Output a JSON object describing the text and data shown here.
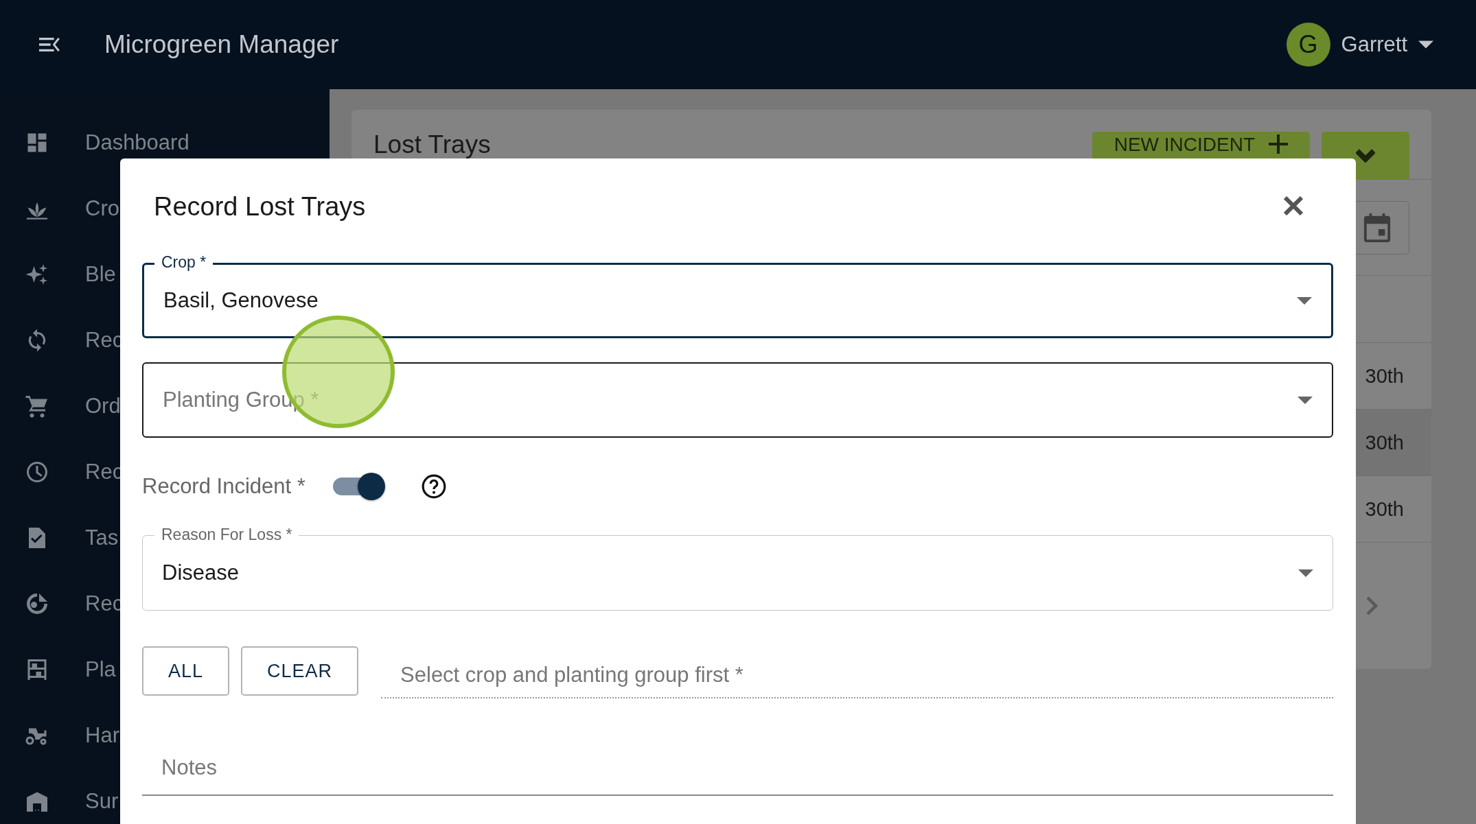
{
  "app_bar": {
    "title": "Microgreen Manager",
    "user": {
      "initial": "G",
      "name": "Garrett"
    }
  },
  "sidebar": {
    "items": [
      {
        "label": "Dashboard",
        "kind": "dashboard"
      },
      {
        "label": "Cro",
        "kind": "sprout"
      },
      {
        "label": "Ble",
        "kind": "sparkle"
      },
      {
        "label": "Rec",
        "kind": "sync"
      },
      {
        "label": "Ord",
        "kind": "cart"
      },
      {
        "label": "Rec",
        "kind": "clock"
      },
      {
        "label": "Tas",
        "kind": "task"
      },
      {
        "label": "Rec",
        "kind": "recycle"
      },
      {
        "label": "Pla",
        "kind": "shelf"
      },
      {
        "label": "Har",
        "kind": "tractor"
      },
      {
        "label": "Sur",
        "kind": "warehouse"
      }
    ]
  },
  "page": {
    "title": "Lost Trays",
    "new_button": "NEW INCIDENT",
    "rows": [
      {
        "cell": "30th",
        "selected": false
      },
      {
        "cell": "30th",
        "selected": true
      },
      {
        "cell": "30th",
        "selected": false
      }
    ]
  },
  "dialog": {
    "title": "Record Lost Trays",
    "fields": [
      {
        "kind": "select",
        "label": "Crop *",
        "value": "Basil, Genovese",
        "focused": true
      },
      {
        "kind": "select",
        "placeholder": "Planting Group *",
        "focused": false,
        "hovered": true
      },
      {
        "kind": "switch",
        "label": "Record Incident *",
        "on": true
      },
      {
        "kind": "select",
        "label": "Reason For Loss *",
        "value": "Disease",
        "focused": false,
        "hovered": false
      },
      {
        "kind": "multi",
        "buttons": [
          "ALL",
          "CLEAR"
        ],
        "placeholder": "Select crop and planting group first *"
      },
      {
        "kind": "text",
        "placeholder": "Notes"
      }
    ]
  }
}
